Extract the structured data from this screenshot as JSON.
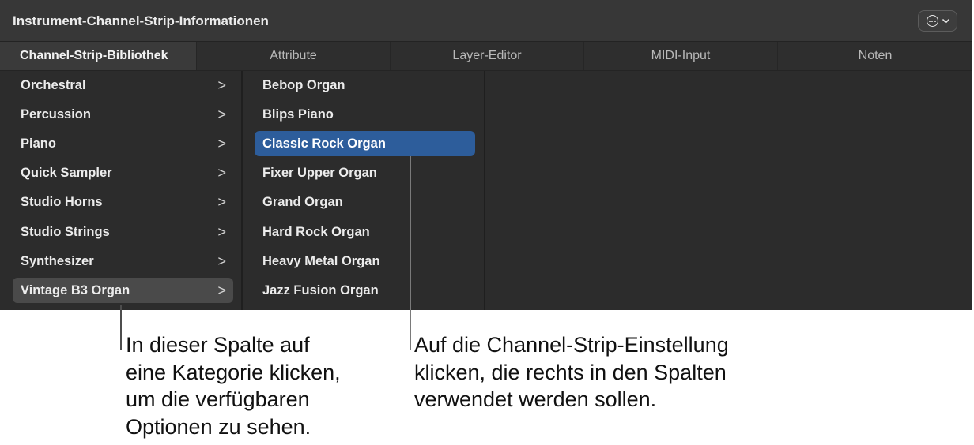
{
  "window": {
    "title": "Instrument-Channel-Strip-Informationen",
    "more_button_icon": "ellipsis-circle-icon",
    "tabs": [
      {
        "label": "Channel-Strip-Bibliothek",
        "active": true
      },
      {
        "label": "Attribute",
        "active": false
      },
      {
        "label": "Layer-Editor",
        "active": false
      },
      {
        "label": "MIDI-Input",
        "active": false
      },
      {
        "label": "Noten",
        "active": false
      }
    ]
  },
  "categories": [
    {
      "label": "Orchestral",
      "selected": false
    },
    {
      "label": "Percussion",
      "selected": false
    },
    {
      "label": "Piano",
      "selected": false
    },
    {
      "label": "Quick Sampler",
      "selected": false
    },
    {
      "label": "Studio Horns",
      "selected": false
    },
    {
      "label": "Studio Strings",
      "selected": false
    },
    {
      "label": "Synthesizer",
      "selected": false
    },
    {
      "label": "Vintage B3 Organ",
      "selected": true
    }
  ],
  "presets": [
    {
      "label": "Bebop Organ",
      "selected": false
    },
    {
      "label": "Blips Piano",
      "selected": false
    },
    {
      "label": "Classic Rock Organ",
      "selected": true
    },
    {
      "label": "Fixer Upper Organ",
      "selected": false
    },
    {
      "label": "Grand Organ",
      "selected": false
    },
    {
      "label": "Hard Rock Organ",
      "selected": false
    },
    {
      "label": "Heavy Metal Organ",
      "selected": false
    },
    {
      "label": "Jazz Fusion Organ",
      "selected": false
    }
  ],
  "chevron_glyph": ">",
  "callouts": {
    "left": "In dieser Spalte auf\neine Kategorie klicken,\num die verfügbaren\nOptionen zu sehen.",
    "right": "Auf die Channel-Strip-Einstellung\nklicken, die rechts in den Spalten\nverwendet werden sollen."
  },
  "colors": {
    "selection_blue": "#2d5d9b",
    "category_highlight": "#4a4a4a",
    "window_bg": "#2c2c2c"
  }
}
